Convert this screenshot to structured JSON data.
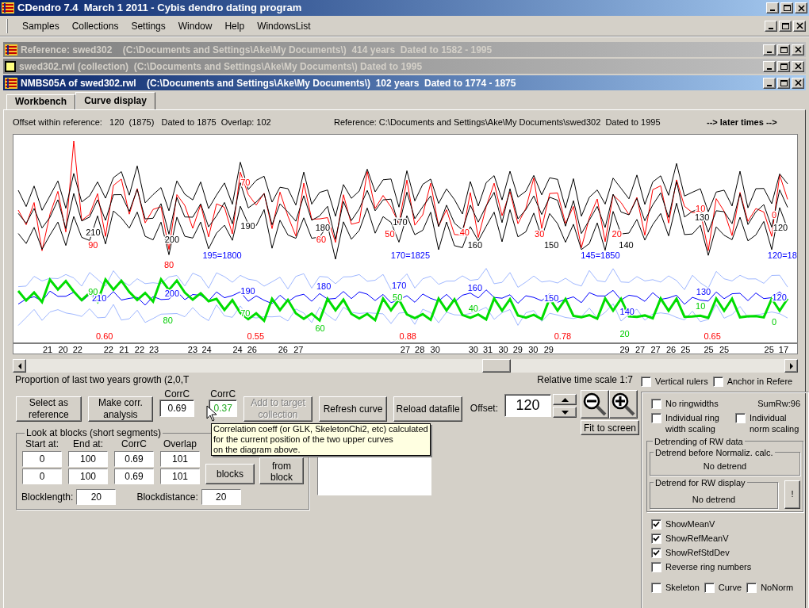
{
  "app": {
    "title": "CDendro 7.4  March 1 2011 - Cybis dendro dating program"
  },
  "menu": [
    "Samples",
    "Collections",
    "Settings",
    "Window",
    "Help",
    "WindowsList"
  ],
  "child_windows": [
    {
      "kind": "app",
      "title": "Reference: swed302    (C:\\Documents and Settings\\Ake\\My Documents\\)  414 years  Dated to 1582 - 1995",
      "active": false
    },
    {
      "kind": "collection",
      "title": "swed302.rwl (collection)  (C:\\Documents and Settings\\Ake\\My Documents\\) Dated to 1995",
      "active": false
    },
    {
      "kind": "app",
      "title": "NMBS05A of swed302.rwl    (C:\\Documents and Settings\\Ake\\My Documents\\)  102 years  Dated to 1774 - 1875",
      "active": true
    }
  ],
  "tabs": [
    {
      "label": "Workbench",
      "selected": false
    },
    {
      "label": "Curve display",
      "selected": true
    }
  ],
  "info_bar": {
    "offset": "Offset within reference:   120  (1875)   Dated to 1875  Overlap: 102",
    "reference": "Reference: C:\\Documents and Settings\\Ake\\My Documents\\swed302  Dated to 1995",
    "later_times": "--> later times -->"
  },
  "chart": {
    "reference_labels": [
      "210",
      "200",
      "190",
      "180",
      "170",
      "160",
      "150",
      "140",
      "130",
      "120"
    ],
    "sample_labels": [
      "90",
      "80",
      "70",
      "60",
      "50",
      "40",
      "30",
      "20",
      "10",
      "0"
    ],
    "year_labels": [
      "195=1800",
      "170=1825",
      "145=1850",
      "120=18"
    ],
    "mean_labels": [
      "210",
      "200",
      "190",
      "180",
      "170",
      "160",
      "150",
      "140",
      "130",
      "120"
    ],
    "sample_mean_labels": [
      "90",
      "80",
      "70",
      "60",
      "50",
      "40",
      "20",
      "10",
      "0"
    ],
    "corr_labels": [
      "0.60",
      "0.55",
      "0.88",
      "0.78",
      "0.65"
    ],
    "ring_counts": [
      "21",
      "20",
      "22",
      "22",
      "21",
      "22",
      "23",
      "23",
      "24",
      "24",
      "26",
      "26",
      "27",
      "27",
      "28",
      "30",
      "30",
      "31",
      "30",
      "29",
      "30",
      "29",
      "29",
      "27",
      "27",
      "26",
      "25",
      "25",
      "25",
      "25",
      "17"
    ]
  },
  "proportion": "Proportion of last two years growth (2,0,T",
  "actions": [
    {
      "label": "Select as reference",
      "disabled": false
    },
    {
      "label": "Make corr. analysis",
      "disabled": false
    }
  ],
  "corr_fields": [
    {
      "label": "CorrC",
      "value": "0.69",
      "kind": "sample"
    },
    {
      "label": "CorrC",
      "value": "0.37",
      "kind": "mean"
    }
  ],
  "actions2": [
    {
      "label": "Add to target collection",
      "disabled": true
    },
    {
      "label": "Refresh curve",
      "disabled": false
    },
    {
      "label": "Reload datafile",
      "disabled": false
    }
  ],
  "offset": {
    "label": "Offset:",
    "value": "120"
  },
  "time_scale": "Relative time scale 1:7",
  "fit_button": "Fit to screen",
  "blocks": {
    "title": "Look at blocks (short segments)",
    "columns": [
      "Start at:",
      "End at:",
      "CorrC",
      "Overlap"
    ],
    "rows": [
      [
        "0",
        "100",
        "0.69",
        "101"
      ],
      [
        "0",
        "100",
        "0.69",
        "101"
      ]
    ],
    "buttons": [
      "blocks",
      "from block"
    ],
    "blocklength_label": "Blocklength:",
    "blocklength": "20",
    "blockdistance_label": "Blockdistance:",
    "blockdistance": "20"
  },
  "tooltip": "Correlation coeff (or GLK, SkeletonChi2, etc) calculated\nfor the current position of the two upper curves\non the diagram above.",
  "top_checks": [
    {
      "label": "Vertical rulers",
      "checked": false
    },
    {
      "label": "Anchor in Refere",
      "checked": false
    }
  ],
  "options": {
    "no_ringwidths": {
      "label": "No ringwidths",
      "checked": false
    },
    "sum_rw": "SumRw:96",
    "ring_scaling": {
      "label": "Individual ring width scaling",
      "checked": false
    },
    "norm_scaling": {
      "label": "Individual norm scaling",
      "checked": false
    }
  },
  "detrending": {
    "title": "Detrending of RW data",
    "before": {
      "title": "Detrend before Normaliz. calc.",
      "value": "No detrend"
    },
    "display": {
      "title": "Detrend for RW display",
      "value": "No detrend"
    },
    "extra_button": "!"
  },
  "show_checks": [
    {
      "label": "ShowMeanV",
      "checked": true
    },
    {
      "label": "ShowRefMeanV",
      "checked": true
    },
    {
      "label": "ShowRefStdDev",
      "checked": true
    },
    {
      "label": "Reverse ring numbers",
      "checked": false
    }
  ],
  "bottom_checks": [
    {
      "label": "Skeleton",
      "checked": false
    },
    {
      "label": "Curve",
      "checked": false
    },
    {
      "label": "NoNorm",
      "checked": false
    }
  ]
}
